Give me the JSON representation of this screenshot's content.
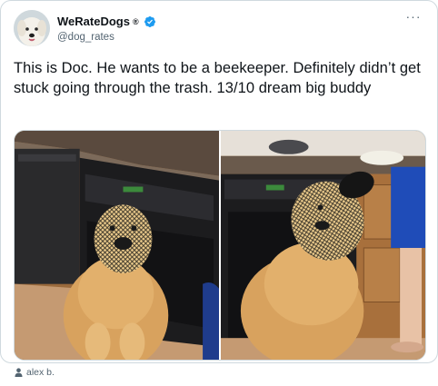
{
  "tweet": {
    "display_name": "WeRateDogs",
    "registered_mark": "®",
    "handle": "@dog_rates",
    "more_glyph": "···",
    "text": "This is Doc. He wants to be a beekeeper. Definitely didn’t get stuck going through the trash. 13/10 dream big buddy"
  },
  "media": {
    "photo_left_alt": "Golden retriever wearing a mesh bag over head in kitchen",
    "photo_right_alt": "Golden retriever wearing a mesh bag over head, side view"
  },
  "credit": {
    "icon": "person-icon",
    "name": "alex b."
  },
  "colors": {
    "verified_blue": "#1d9bf0",
    "secondary_text": "#536471",
    "border": "#cfd9de"
  }
}
